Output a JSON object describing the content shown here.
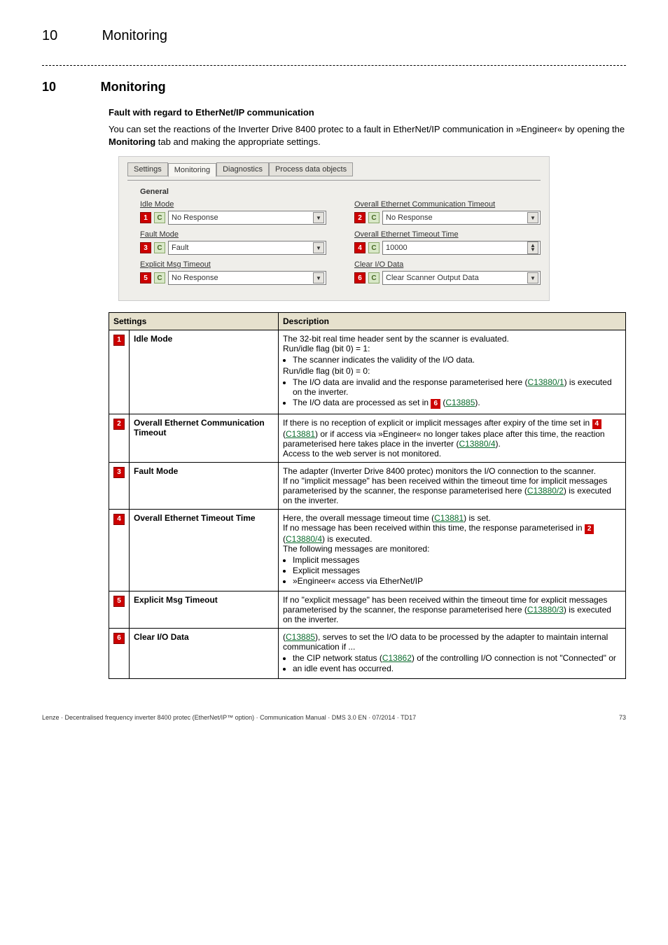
{
  "running_head": {
    "num": "10",
    "title": "Monitoring"
  },
  "section": {
    "num": "10",
    "title": "Monitoring"
  },
  "subhead": "Fault with regard to EtherNet/IP communication",
  "intro_1": "You can set the reactions of the Inverter Drive 8400 protec to a fault in EtherNet/IP communication in »Engineer« by opening the ",
  "intro_bold": "Monitoring",
  "intro_2": " tab and making the appropriate settings.",
  "panel": {
    "tabs": [
      "Settings",
      "Monitoring",
      "Diagnostics",
      "Process data objects"
    ],
    "group_title": "General",
    "fields": {
      "idle_mode": {
        "label": "Idle Mode",
        "num": "1",
        "value": "No Response"
      },
      "overall_comm_timeout": {
        "label": "Overall Ethernet Communication Timeout",
        "num": "2",
        "value": "No Response"
      },
      "fault_mode": {
        "label": "Fault Mode",
        "num": "3",
        "value": "Fault"
      },
      "overall_timeout_time": {
        "label": "Overall Ethernet Timeout Time",
        "num": "4",
        "value": "10000"
      },
      "explicit_msg_timeout": {
        "label": "Explicit Msg Timeout",
        "num": "5",
        "value": "No Response"
      },
      "clear_io_data": {
        "label": "Clear I/O Data",
        "num": "6",
        "value": "Clear Scanner Output Data"
      }
    },
    "c_label": "C"
  },
  "table": {
    "head_settings": "Settings",
    "head_description": "Description",
    "rows": [
      {
        "num": "1",
        "name": "Idle Mode",
        "desc": {
          "l1": "The 32-bit real time header sent by the scanner is evaluated.",
          "l2": "Run/idle flag (bit 0) = 1:",
          "b1": "The scanner indicates the validity of the I/O data.",
          "l3": "Run/idle flag (bit 0) = 0:",
          "b2a": "The I/O data are invalid and the response parameterised here (",
          "b2link": "C13880/1",
          "b2b": ") is executed on the inverter.",
          "b3a": "The I/O data are processed as set in ",
          "b3badge": "6",
          "b3b": " (",
          "b3link": "C13885",
          "b3c": ")."
        }
      },
      {
        "num": "2",
        "name": "Overall Ethernet Communication Timeout",
        "desc": {
          "l1a": "If there is no reception of explicit or implicit messages after expiry of the time set in ",
          "l1badge": "4",
          "l1b": " (",
          "l1link": "C13881",
          "l1c": ") or if access via »Engineer« no longer takes place after this time, the reaction parameterised here takes place in the inverter (",
          "l1link2": "C13880/4",
          "l1d": ").",
          "l2": "Access to the web server is not monitored."
        }
      },
      {
        "num": "3",
        "name": "Fault Mode",
        "desc": {
          "l1": "The adapter (Inverter Drive 8400 protec) monitors the I/O connection to the scanner.",
          "l2a": "If no \"implicit message\" has been received within the timeout time for implicit messages parameterised by the scanner, the response parameterised here (",
          "l2link": "C13880/2",
          "l2b": ") is executed on the inverter."
        }
      },
      {
        "num": "4",
        "name": "Overall Ethernet Timeout Time",
        "desc": {
          "l1a": "Here, the overall message timeout time (",
          "l1link": "C13881",
          "l1b": ") is set.",
          "l2a": "If no message has been received within this time, the response parameterised in ",
          "l2badge": "2",
          "l2b": " (",
          "l2link": "C13880/4",
          "l2c": ") is executed.",
          "l3": "The following messages are monitored:",
          "b1": "Implicit messages",
          "b2": "Explicit messages",
          "b3": "»Engineer« access via EtherNet/IP"
        }
      },
      {
        "num": "5",
        "name": "Explicit Msg Timeout",
        "desc": {
          "l1a": "If no \"explicit message\" has been received within the timeout time for explicit messages parameterised by the scanner, the response parameterised here (",
          "l1link": "C13880/3",
          "l1b": ") is executed on the inverter."
        }
      },
      {
        "num": "6",
        "name": "Clear I/O Data",
        "desc": {
          "l1a": "(",
          "l1link": "C13885",
          "l1b": "), serves to set the I/O data to be processed by the adapter to maintain internal communication if ...",
          "b1a": "the CIP network status (",
          "b1link": "C13862",
          "b1b": ") of the controlling I/O connection is not \"Connected\" or",
          "b2": "an idle event has occurred."
        }
      }
    ]
  },
  "footer_left": "Lenze · Decentralised frequency inverter 8400 protec (EtherNet/IP™ option) · Communication Manual · DMS 3.0 EN · 07/2014 · TD17",
  "footer_right": "73"
}
